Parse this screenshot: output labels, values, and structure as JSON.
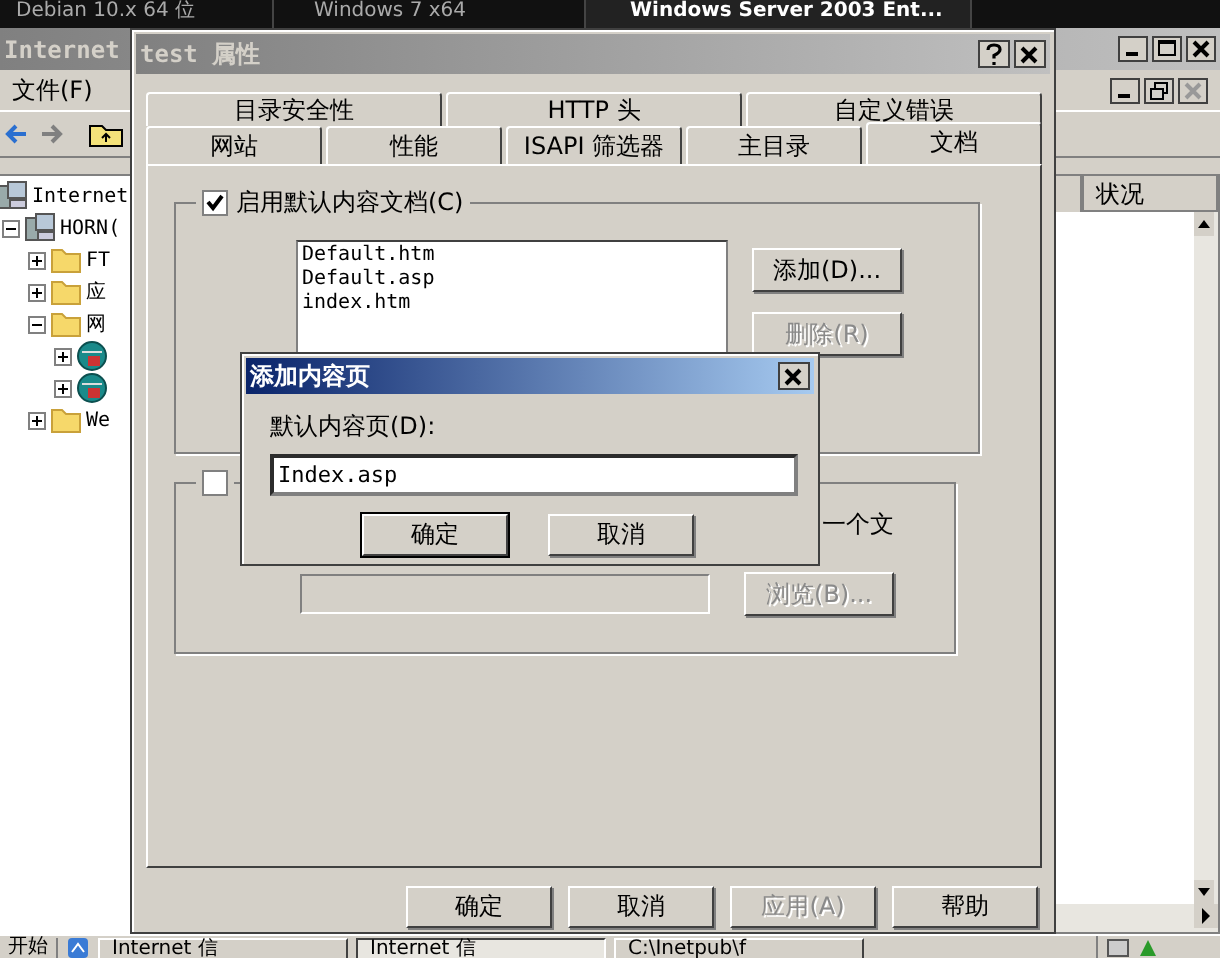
{
  "host_tabs": [
    {
      "label": "Debian 10.x 64 位",
      "selected": false
    },
    {
      "label": "Windows 7 x64",
      "selected": false
    },
    {
      "label": "Windows Server 2003 Ent...",
      "selected": true
    }
  ],
  "background_window": {
    "title": "Internet",
    "menu": [
      "文件(F)"
    ],
    "tree": [
      {
        "label": "Internet",
        "kind": "computer",
        "children": [
          {
            "label": "HORN(",
            "kind": "computer",
            "expanded": true,
            "children": [
              {
                "label": "FT",
                "kind": "folder",
                "expanded": false
              },
              {
                "label": "应",
                "kind": "folder",
                "expanded": false
              },
              {
                "label": "网",
                "kind": "folder",
                "expanded": true,
                "children": [
                  {
                    "kind": "site",
                    "expanded": false
                  },
                  {
                    "kind": "site",
                    "expanded": false
                  }
                ]
              },
              {
                "label": "We",
                "kind": "folder",
                "expanded": false
              }
            ]
          }
        ]
      }
    ],
    "list_columns": [
      "状况"
    ]
  },
  "dialog": {
    "title": "test 属性",
    "tabs_back": [
      {
        "label": "目录安全性",
        "selected": false
      },
      {
        "label": "HTTP 头",
        "selected": false
      },
      {
        "label": "自定义错误",
        "selected": false
      }
    ],
    "tabs_front": [
      {
        "label": "网站",
        "selected": false
      },
      {
        "label": "性能",
        "selected": false
      },
      {
        "label": "ISAPI 筛选器",
        "selected": false
      },
      {
        "label": "主目录",
        "selected": false
      },
      {
        "label": "文档",
        "selected": true
      }
    ],
    "default_docs": {
      "label": "启用默认内容文档(C)",
      "checked": true,
      "documents": [
        "Default.htm",
        "Default.asp",
        "index.htm"
      ],
      "buttons": [
        {
          "label": "添加(D)...",
          "disabled": false
        },
        {
          "label": "删除(R)",
          "disabled": true
        }
      ]
    },
    "footer_group": {
      "checked": false,
      "text_fragment": "一个文",
      "path_field": {
        "disabled": true
      },
      "browse": {
        "label": "浏览(B)...",
        "disabled": true
      }
    },
    "buttons": [
      {
        "label": "确定",
        "disabled": false
      },
      {
        "label": "取消",
        "disabled": false
      },
      {
        "label": "应用(A)",
        "disabled": true
      },
      {
        "label": "帮助",
        "disabled": false
      }
    ]
  },
  "add_dialog": {
    "title": "添加内容页",
    "label": "默认内容页(D):",
    "value": "Index.asp",
    "buttons": [
      {
        "label": "确定",
        "default": true
      },
      {
        "label": "取消",
        "default": false
      }
    ]
  },
  "taskbar": {
    "start": "开始",
    "tasks": [
      {
        "label": "Internet 信",
        "selected": false
      },
      {
        "label": "Internet 信",
        "selected": true
      },
      {
        "label": "C:\\Inetpub\\f",
        "selected": false
      }
    ]
  }
}
